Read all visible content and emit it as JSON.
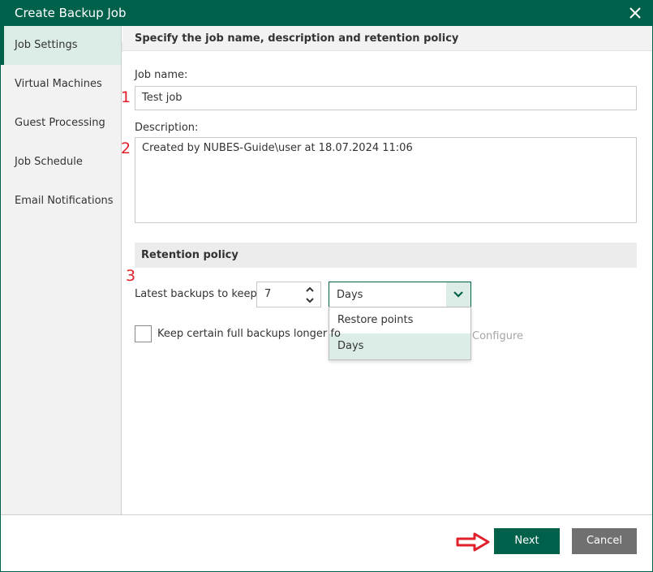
{
  "window": {
    "title": "Create Backup Job",
    "close_icon": "close-icon"
  },
  "sidebar": {
    "items": [
      {
        "label": "Job Settings",
        "active": true
      },
      {
        "label": "Virtual Machines",
        "active": false
      },
      {
        "label": "Guest Processing",
        "active": false
      },
      {
        "label": "Job Schedule",
        "active": false
      },
      {
        "label": "Email Notifications",
        "active": false
      }
    ]
  },
  "header": {
    "text": "Specify the job name, description and retention policy"
  },
  "form": {
    "job_name_label": "Job name:",
    "job_name_value": "Test job",
    "description_label": "Description:",
    "description_value": "Created by NUBES-Guide\\user at 18.07.2024 11:06",
    "retention": {
      "title": "Retention policy",
      "keep_label": "Latest backups to keep:",
      "keep_value": "7",
      "unit_selected": "Days",
      "unit_options": [
        "Restore points",
        "Days"
      ],
      "checkbox_label": "Keep certain full backups longer fo",
      "checkbox_checked": false,
      "configure_label": "Configure"
    }
  },
  "annotations": {
    "marker_1": "1",
    "marker_2": "2",
    "marker_3": "3",
    "arrow_color": "#e0212b"
  },
  "footer": {
    "next_label": "Next",
    "cancel_label": "Cancel"
  },
  "colors": {
    "accent": "#00614a",
    "accent_light": "#dbede6",
    "cancel": "#707070"
  }
}
